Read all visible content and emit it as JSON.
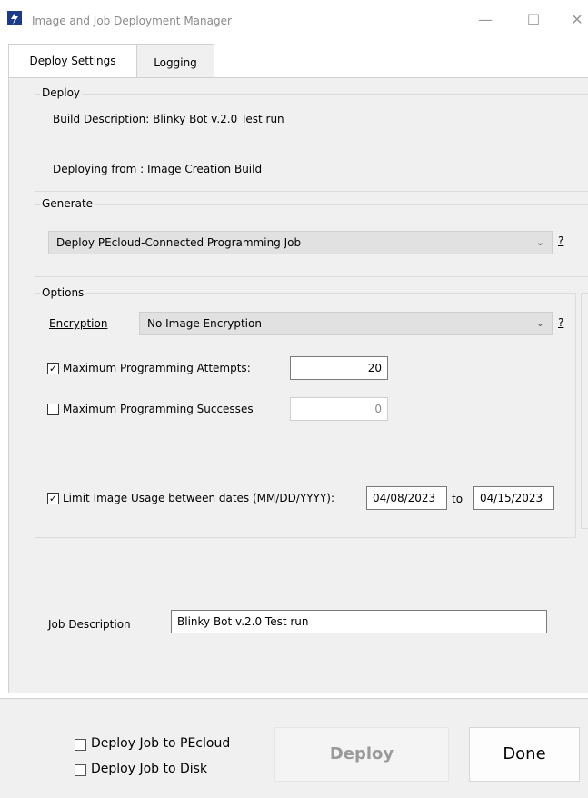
{
  "window": {
    "title": "Image and Job Deployment Manager",
    "minimize": "—",
    "maximize": "☐",
    "close": "✕"
  },
  "tabs": [
    "Deploy Settings",
    "Logging"
  ],
  "deploy": {
    "legend": "Deploy",
    "build_description": "Build Description: Blinky Bot v.2.0 Test run",
    "deploying_from": "Deploying from : Image Creation Build"
  },
  "generate": {
    "legend": "Generate",
    "selected": "Deploy PEcloud-Connected Programming Job",
    "help": "?"
  },
  "options": {
    "legend": "Options",
    "encryption_label": "Encryption",
    "encryption_selected": "No Image Encryption",
    "help": "?",
    "max_attempts_label": "Maximum Programming Attempts:",
    "max_attempts_checked": true,
    "max_attempts_value": "20",
    "max_successes_label": "Maximum Programming Successes",
    "max_successes_checked": false,
    "max_successes_value": "0",
    "limit_dates_label": "Limit Image Usage between dates (MM/DD/YYYY):",
    "limit_dates_checked": true,
    "date_from": "04/08/2023",
    "date_to_label": "to",
    "date_to": "04/15/2023"
  },
  "job": {
    "label": "Job Description",
    "value": "Blinky Bot v.2.0 Test run"
  },
  "bottom": {
    "deploy_pecloud_label": "Deploy Job to PEcloud",
    "deploy_disk_label": "Deploy Job to Disk",
    "deploy_button": "Deploy",
    "done_button": "Done"
  },
  "colors": {
    "app_icon": "#1a3a8c",
    "panel_bg": "#f0f0f0"
  }
}
